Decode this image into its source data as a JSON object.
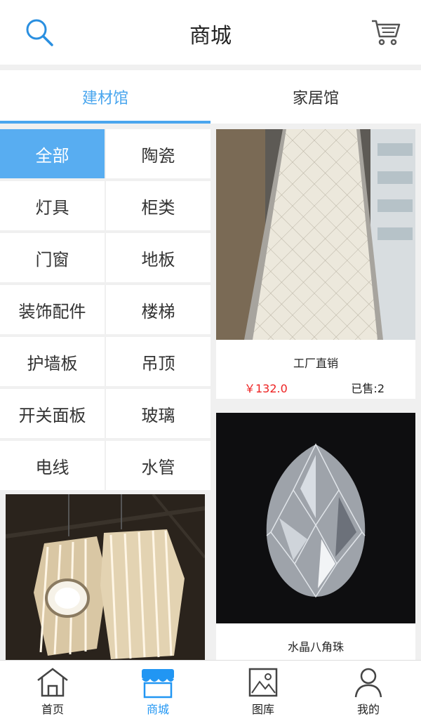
{
  "header": {
    "title": "商城",
    "search_icon": "search-icon",
    "cart_icon": "cart-icon"
  },
  "tabs": [
    {
      "label": "建材馆",
      "active": true
    },
    {
      "label": "家居馆",
      "active": false
    }
  ],
  "categories": [
    {
      "label": "全部",
      "active": true
    },
    {
      "label": "陶瓷"
    },
    {
      "label": "灯具"
    },
    {
      "label": "柜类"
    },
    {
      "label": "门窗"
    },
    {
      "label": "地板"
    },
    {
      "label": "装饰配件"
    },
    {
      "label": "楼梯"
    },
    {
      "label": "护墙板"
    },
    {
      "label": "吊顶"
    },
    {
      "label": "开关面板"
    },
    {
      "label": "玻璃"
    },
    {
      "label": "电线"
    },
    {
      "label": "水管"
    }
  ],
  "products": [
    {
      "name": "工厂直销",
      "price": "￥132.0",
      "sold": "已售:2"
    },
    {
      "name": "水晶八角珠"
    }
  ],
  "bottom_nav": [
    {
      "label": "首页",
      "icon": "home-icon",
      "active": false
    },
    {
      "label": "商城",
      "icon": "store-icon",
      "active": true
    },
    {
      "label": "图库",
      "icon": "gallery-icon",
      "active": false
    },
    {
      "label": "我的",
      "icon": "user-icon",
      "active": false
    }
  ],
  "colors": {
    "accent": "#4aa6ee",
    "price": "#e22222"
  }
}
